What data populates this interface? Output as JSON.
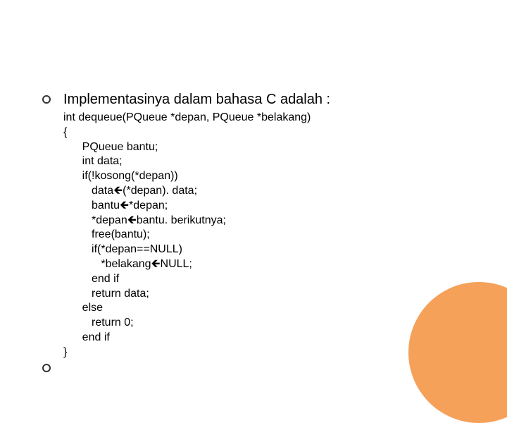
{
  "heading": "Implementasinya dalam bahasa C adalah :",
  "code": {
    "l0": "int dequeue(PQueue *depan, PQueue *belakang)",
    "l1": "{",
    "l2": "      PQueue bantu;",
    "l3": "      int data;",
    "l4": "      if(!kosong(*depan))",
    "l5a": "         data",
    "l5b": "(*depan). data;",
    "l6a": "         bantu",
    "l6b": "*depan;",
    "l7a": "         *depan",
    "l7b": "bantu. berikutnya;",
    "l8": "         free(bantu);",
    "l9": "         if(*depan==NULL)",
    "l10a": "            *belakang",
    "l10b": "NULL;",
    "l11": "         end if",
    "l12": "         return data;",
    "l13": "      else",
    "l14": "         return 0;",
    "l15": "      end if",
    "l16": "}"
  },
  "arrow": "🡸"
}
